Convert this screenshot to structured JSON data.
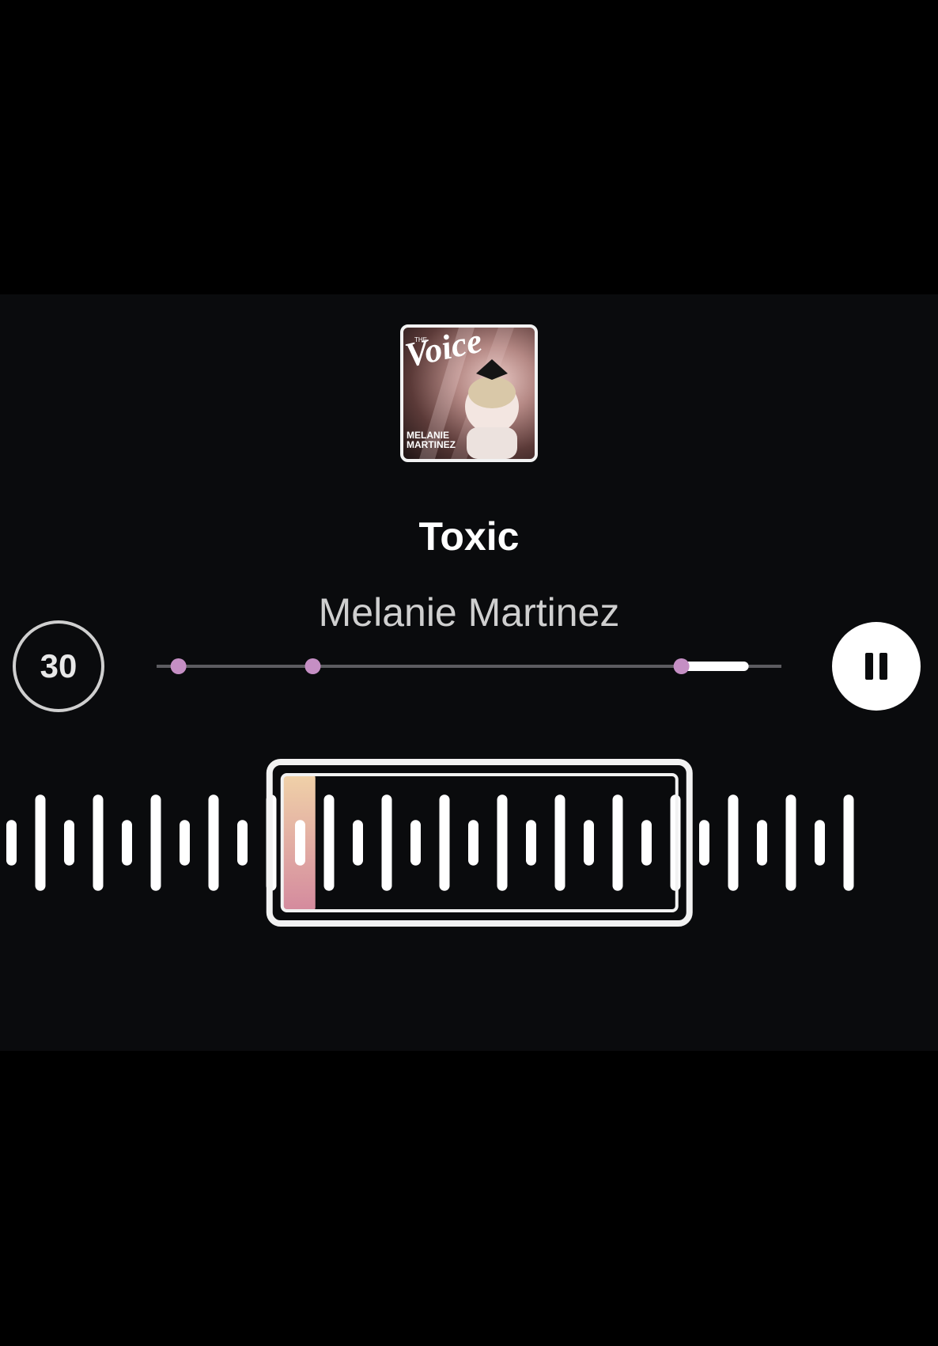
{
  "track": {
    "title": "Toxic",
    "artist": "Melanie Martinez"
  },
  "album_art": {
    "logo_text": "Voice",
    "logo_small_text": "THE",
    "caption_line1": "MELANIE",
    "caption_line2": "MARTINEZ"
  },
  "controls": {
    "skip_label": "30",
    "skip_icon": "skip-30-icon",
    "pause_icon": "pause-icon"
  },
  "progress": {
    "fraction": 0.94,
    "segment_start_fraction": 0.84,
    "markers": [
      0.035,
      0.25,
      0.84
    ]
  },
  "colors": {
    "background": "#0a0b0d",
    "marker": "#c58fc4",
    "track_line": "#5c5c60",
    "wave_bar": "#ffffff",
    "accent_top": "#f0d1a8",
    "accent_bottom": "#d48a9e"
  },
  "waveform": {
    "heights": [
      0.45,
      0.95,
      0.45,
      0.95,
      0.45,
      0.95,
      0.45,
      0.95,
      0.45,
      0.95,
      0.45,
      0.95,
      0.45,
      0.95,
      0.45,
      0.95,
      0.45,
      0.95,
      0.45,
      0.95,
      0.45,
      0.95,
      0.45,
      0.95,
      0.45,
      0.95,
      0.45,
      0.95,
      0.45,
      0.95
    ],
    "selection_start_bar": 10,
    "selection_end_bar": 23
  }
}
